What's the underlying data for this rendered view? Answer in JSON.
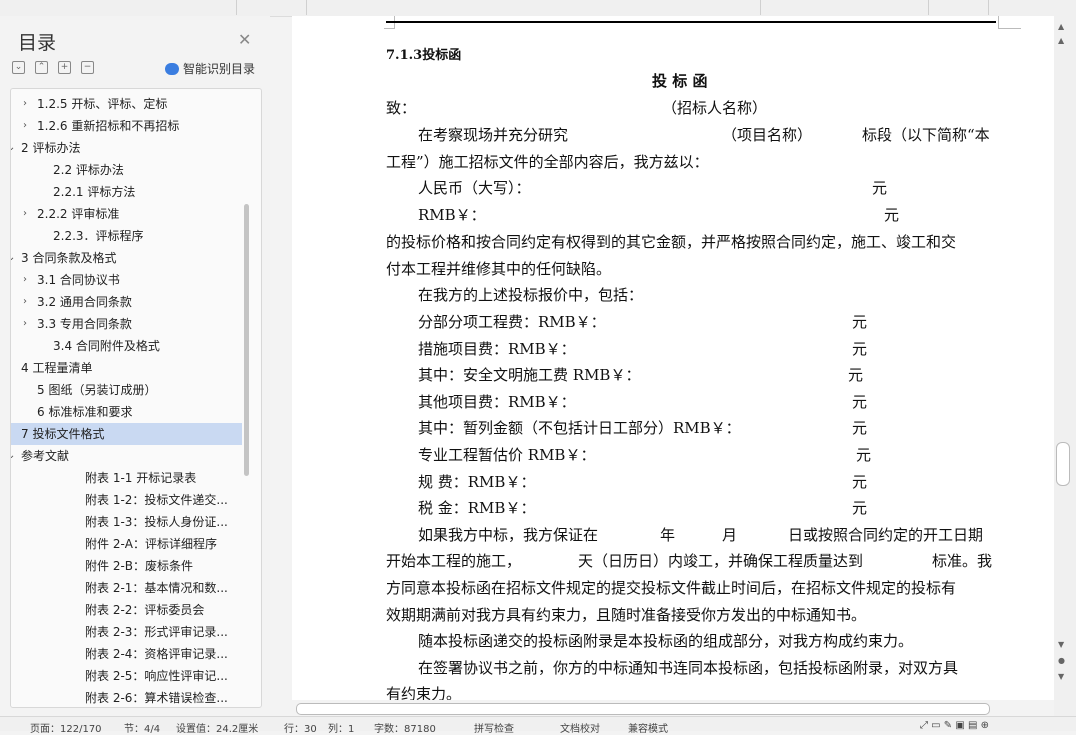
{
  "sidebar": {
    "title": "目录",
    "ai_label": "智能识别目录",
    "items": [
      {
        "label": "1.2.5 开标、评标、定标",
        "arrow": "›"
      },
      {
        "label": "1.2.6 重新招标和不再招标",
        "arrow": "›"
      },
      {
        "label": "2 评标办法",
        "arrow": "⌄"
      },
      {
        "label": "2.2 评标办法",
        "arrow": ""
      },
      {
        "label": "2.2.1 评标方法",
        "arrow": ""
      },
      {
        "label": "2.2.2 评审标准",
        "arrow": "›"
      },
      {
        "label": "2.2.3．评标程序",
        "arrow": ""
      },
      {
        "label": "3 合同条款及格式",
        "arrow": "⌄"
      },
      {
        "label": "3.1  合同协议书",
        "arrow": "›"
      },
      {
        "label": "3.2  通用合同条款",
        "arrow": "›"
      },
      {
        "label": "3.3  专用合同条款",
        "arrow": "›"
      },
      {
        "label": "3.4  合同附件及格式",
        "arrow": ""
      },
      {
        "label": "4 工程量清单",
        "arrow": "›"
      },
      {
        "label": "5 图纸（另装订成册）",
        "arrow": ""
      },
      {
        "label": "6  标准标准和要求",
        "arrow": ""
      },
      {
        "label": "7 投标文件格式",
        "arrow": "›"
      },
      {
        "label": "参考文献",
        "arrow": "⌄"
      },
      {
        "label": "附表 1-1  开标记录表",
        "arrow": ""
      },
      {
        "label": "附表 1-2：投标文件递交...",
        "arrow": ""
      },
      {
        "label": "附表 1-3：投标人身份证...",
        "arrow": ""
      },
      {
        "label": "附件 2-A：评标详细程序",
        "arrow": ""
      },
      {
        "label": "附件 2-B：废标条件",
        "arrow": ""
      },
      {
        "label": "附表 2-1：基本情况和数...",
        "arrow": ""
      },
      {
        "label": "附表 2-2：评标委员会",
        "arrow": ""
      },
      {
        "label": "附表 2-3：形式评审记录...",
        "arrow": ""
      },
      {
        "label": "附表 2-4：资格评审记录...",
        "arrow": ""
      },
      {
        "label": "附表 2-5：响应性评审记...",
        "arrow": ""
      },
      {
        "label": "附表 2-6：算术错误检查...",
        "arrow": ""
      }
    ]
  },
  "document": {
    "section": "7.1.3投标函",
    "heading": "投  标  函",
    "to": "致：",
    "to_hint": "（招标人名称）",
    "p1a": "在考察现场并充分研究",
    "p1b": "（项目名称）",
    "p1c": "标段（以下简称“本",
    "p1d": "工程”）施工招标文件的全部内容后，我方兹以：",
    "rmb_upper": "人民币（大写）：",
    "rmb_sym": "RMB￥：",
    "yuan": "元",
    "p2a": "的投标价格和按合同约定有权得到的其它金额，并严格按照合同约定，施工、竣工和交",
    "p2b": "付本工程并维修其中的任何缺陷。",
    "p3": "在我方的上述投标报价中，包括：",
    "fee1": "分部分项工程费：RMB￥：",
    "fee2": "措施项目费：RMB￥：",
    "fee3": "其中：安全文明施工费 RMB￥：",
    "fee4": "其他项目费：RMB￥：",
    "fee5": "其中：暂列金额（不包括计日工部分）RMB￥：",
    "fee6": "专业工程暂估价 RMB￥：",
    "fee7": "规    费：RMB￥：",
    "fee8": "税    金：RMB￥：",
    "p4a": "如果我方中标，我方保证在",
    "p4b": "年",
    "p4c": "月",
    "p4d": "日或按照合同约定的开工日期",
    "p4e": "开始本工程的施工，",
    "p4f": "天（日历日）内竣工，并确保工程质量达到",
    "p4g": "标准。我",
    "p4h": "方同意本投标函在招标文件规定的提交投标文件截止时间后，在招标文件规定的投标有",
    "p4i": "效期期满前对我方具有约束力，且随时准备接受你方发出的中标通知书。",
    "p5": "随本投标函递交的投标函附录是本投标函的组成部分，对我方构成约束力。",
    "p6a": "在签署协议书之前，你方的中标通知书连同本投标函，包括投标函附录，对双方具",
    "p6b": "有约束力。"
  },
  "status": {
    "page": "页面：122/170",
    "section": "节：4/4",
    "setting": "设置值：24.2厘米",
    "row": "行：30",
    "col": "列：1",
    "words": "字数：87180",
    "spell": "拼写检查",
    "proof": "文档校对",
    "mode": "兼容模式"
  }
}
